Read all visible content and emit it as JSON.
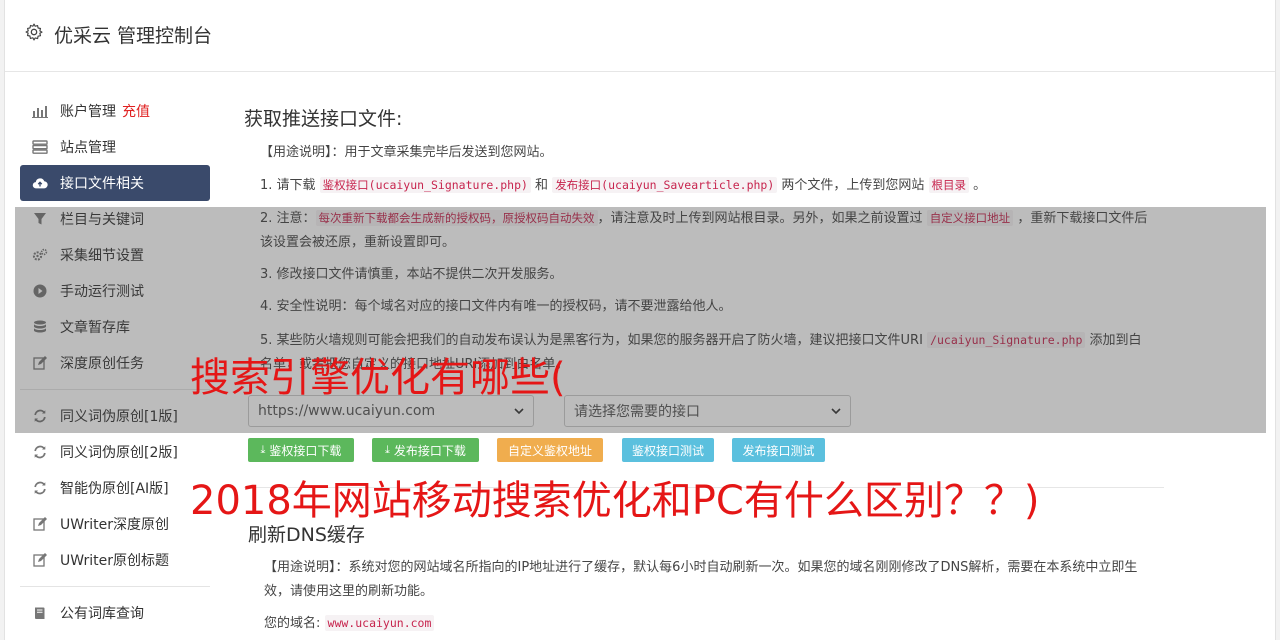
{
  "header": {
    "title": "优采云 管理控制台"
  },
  "sidebar": {
    "items": [
      {
        "label": "账户管理",
        "badge": "充值",
        "icon": "bar-chart-icon"
      },
      {
        "label": "站点管理",
        "icon": "server-icon"
      },
      {
        "label": "接口文件相关",
        "icon": "cloud-upload-icon",
        "active": true
      },
      {
        "label": "栏目与关键词",
        "icon": "filter-icon"
      },
      {
        "label": "采集细节设置",
        "icon": "cogs-icon"
      },
      {
        "label": "手动运行测试",
        "icon": "play-circle-icon"
      },
      {
        "label": "文章暂存库",
        "icon": "database-icon"
      },
      {
        "label": "深度原创任务",
        "icon": "edit-icon"
      },
      {
        "label": "同义词伪原创[1版]",
        "icon": "refresh-icon"
      },
      {
        "label": "同义词伪原创[2版]",
        "icon": "refresh-icon"
      },
      {
        "label": "智能伪原创[AI版]",
        "icon": "refresh-icon"
      },
      {
        "label": "UWriter深度原创",
        "icon": "edit-icon"
      },
      {
        "label": "UWriter原创标题",
        "icon": "edit-icon"
      },
      {
        "label": "公有词库查询",
        "icon": "book-icon"
      }
    ]
  },
  "section1": {
    "title": "获取推送接口文件:",
    "usage": "【用途说明】：用于文章采集完毕后发送到您网站。",
    "s1": {
      "a": "1. 请下载 ",
      "c1": "鉴权接口(ucaiyun_Signature.php)",
      "b": " 和 ",
      "c2": "发布接口(ucaiyun_Savearticle.php)",
      "c": " 两个文件，上传到您网站 ",
      "c3": "根目录",
      "d": " 。"
    },
    "s2": {
      "a": "2. 注意：",
      "c1": "每次重新下载都会生成新的授权码，原授权码自动失效",
      "b": "，请注意及时上传到网站根目录。另外，如果之前设置过 ",
      "c2": "自定义接口地址",
      "c": " ，重新下载接口文件后该设置会被还原，重新设置即可。"
    },
    "s3": "3. 修改接口文件请慎重，本站不提供二次开发服务。",
    "s4": "4. 安全性说明：每个域名对应的接口文件内有唯一的授权码，请不要泄露给他人。",
    "s5": {
      "a": "5. 某些防火墙规则可能会把我们的自动发布误认为是黑客行为，如果您的服务器开启了防火墙，建议把接口文件URI ",
      "c1": "/ucaiyun_Signature.php",
      "b": " 添加到白名单，或者把您自定义的接口地址URI添加到白名单。"
    }
  },
  "selects": {
    "domain": "https://www.ucaiyun.com",
    "interface": "请选择您需要的接口"
  },
  "buttons": {
    "auth_download": "鉴权接口下载",
    "publish_download": "发布接口下载",
    "custom_auth": "自定义鉴权地址",
    "auth_test": "鉴权接口测试",
    "publish_test": "发布接口测试"
  },
  "section2": {
    "title": "刷新DNS缓存",
    "usage": "【用途说明】：系统对您的网站域名所指向的IP地址进行了缓存，默认每6小时自动刷新一次。如果您的域名刚刚修改了DNS解析，需要在本系统中立即生效，请使用这里的刷新功能。",
    "domain_label": "您的域名:",
    "domain_value": "www.ucaiyun.com"
  },
  "overlay_text": {
    "line1": "搜索引擎优化有哪些(",
    "line2": "2018年网站移动搜索优化和PC有什么区别？？)"
  },
  "colors": {
    "sidebar_active": "#3a4a6b",
    "green": "#5cb85c",
    "orange": "#f0ad4e",
    "blue": "#5bc0de",
    "code": "#c7254e",
    "overlay_red": "#e51616"
  }
}
